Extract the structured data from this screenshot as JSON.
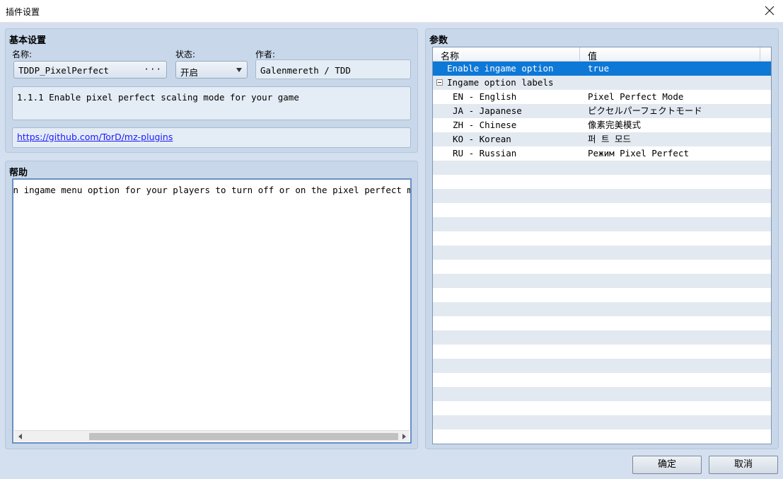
{
  "window": {
    "title": "插件设置",
    "close_icon": "close-icon"
  },
  "basic": {
    "title": "基本设置",
    "name_label": "名称:",
    "name_value": "TDDP_PixelPerfect",
    "name_button": "···",
    "status_label": "状态:",
    "status_value": "开启",
    "author_label": "作者:",
    "author_value": "Galenmereth / TDD",
    "description": "1.1.1 Enable pixel perfect scaling mode for your game",
    "url": "https://github.com/TorD/mz-plugins"
  },
  "help": {
    "title": "帮助",
    "text": "an ingame menu option for your players to turn off or on the pixel perfect mode"
  },
  "params": {
    "title": "参数",
    "col_name": "名称",
    "col_value": "值",
    "rows": [
      {
        "name": "Enable ingame option",
        "value": "true",
        "selected": true
      },
      {
        "name": "Ingame option labels",
        "value": "",
        "expandable": true
      },
      {
        "name": "EN - English",
        "value": "Pixel Perfect Mode"
      },
      {
        "name": "JA - Japanese",
        "value": "ピクセルパーフェクトモード"
      },
      {
        "name": "ZH - Chinese",
        "value": "像素完美模式"
      },
      {
        "name": "KO - Korean",
        "value": "퍼 트 모드"
      },
      {
        "name": "RU - Russian",
        "value": "Режим Pixel Perfect"
      }
    ]
  },
  "buttons": {
    "ok": "确定",
    "cancel": "取消"
  },
  "colors": {
    "selection": "#0e78d7",
    "panel": "#c8d8ea",
    "background": "#d4e0ef"
  }
}
